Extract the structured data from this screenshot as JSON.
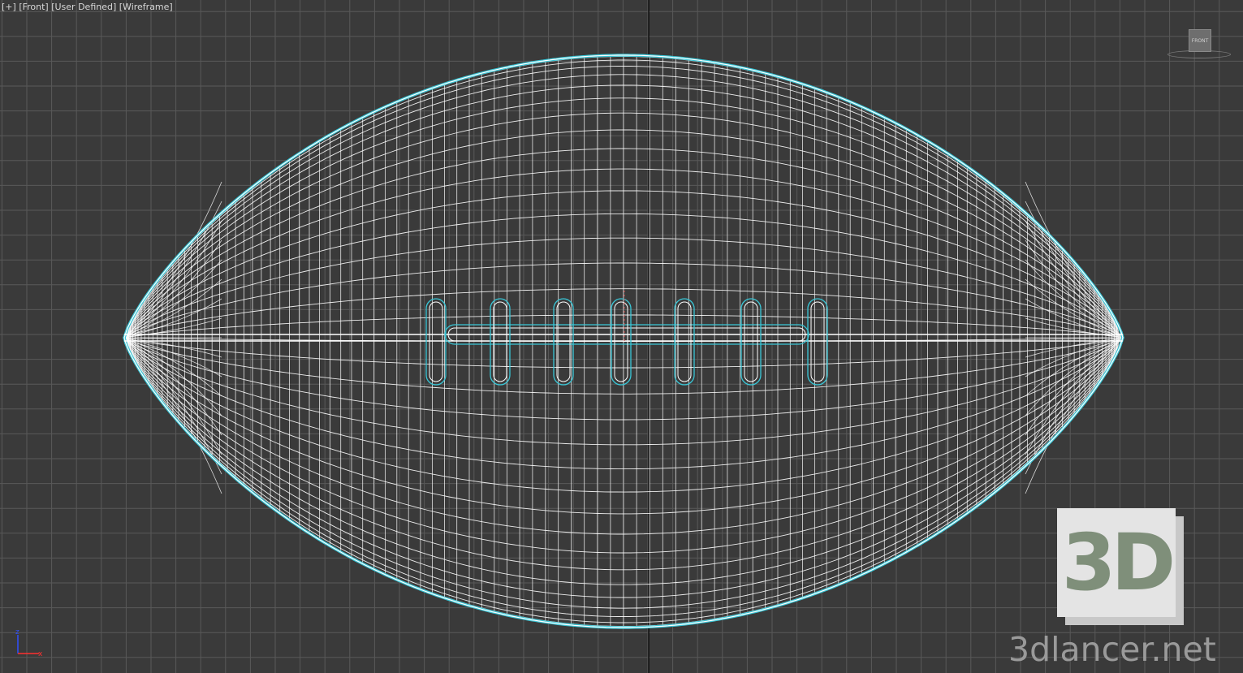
{
  "viewport": {
    "label_parts": [
      "[+]",
      "[Front]",
      "[User Defined]",
      "[Wireframe]"
    ],
    "view_name": "Front",
    "shading_mode": "Wireframe",
    "grid_color": "#595959",
    "background_color": "#3a3a3a",
    "axis_line_color": "#000000"
  },
  "viewcube": {
    "face_label": "FRONT"
  },
  "model": {
    "name": "american-football",
    "outline_color": "#39c6d6",
    "wire_color": "#ffffff",
    "lace_count": 7
  },
  "axis_tripod": {
    "axes": [
      "z",
      "x"
    ],
    "colors": {
      "z": "#3050ff",
      "x": "#ff3030"
    }
  },
  "watermark": {
    "badge_text": "3D",
    "site_text": "3dlancer.net"
  }
}
